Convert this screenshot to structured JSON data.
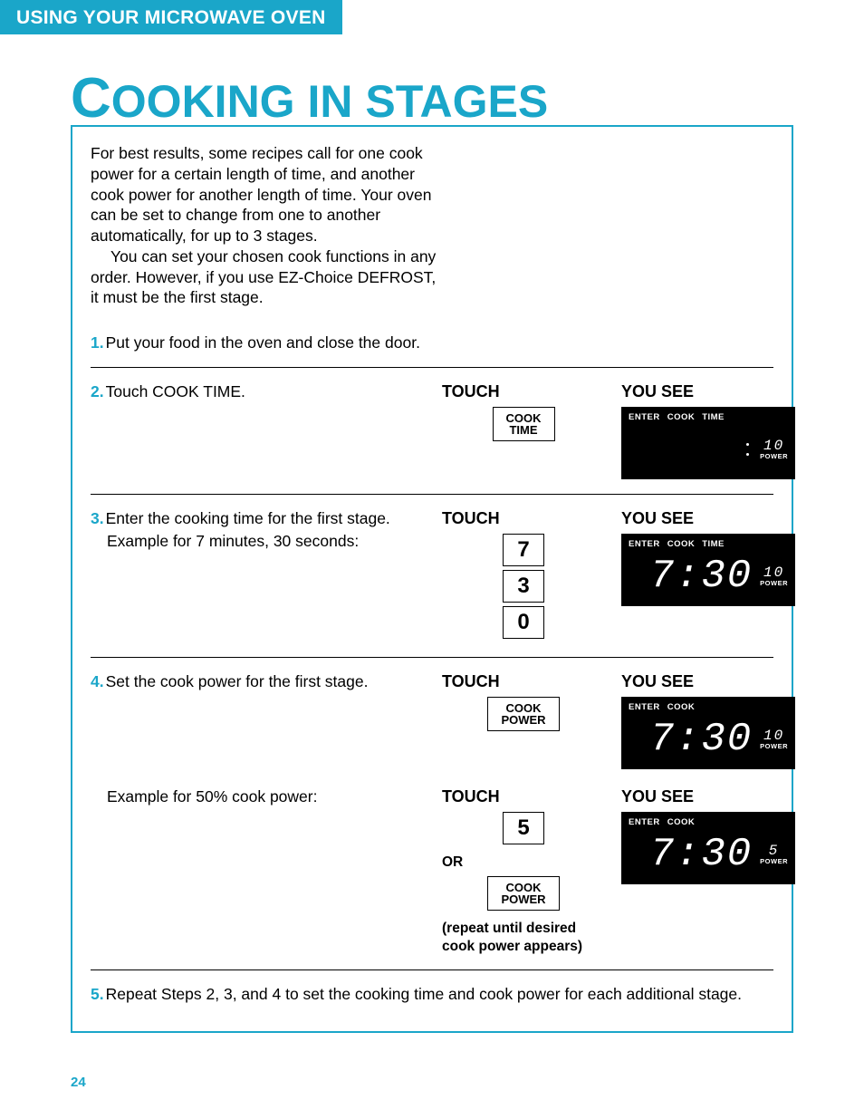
{
  "header": {
    "tab": "USING YOUR MICROWAVE OVEN"
  },
  "title": {
    "initial": "C",
    "rest": "OOKING IN STAGES"
  },
  "intro": {
    "p1": "For best results, some recipes call for one cook power for a certain length of time, and another cook power for another length of time. Your oven can be set to change from one to another automatically, for up to 3 stages.",
    "p2": "You can set your chosen cook functions in any order. However, if you use EZ-Choice DEFROST, it must be the first stage."
  },
  "steps": {
    "s1": {
      "num": "1.",
      "text": "Put your food in the oven and close the door."
    },
    "s2": {
      "num": "2.",
      "text": "Touch COOK TIME.",
      "touch": "TOUCH",
      "btn1a": "COOK",
      "btn1b": "TIME",
      "see": "YOU SEE",
      "lcdTop1": "ENTER",
      "lcdTop2": "COOK",
      "lcdTop3": "TIME",
      "lcdPwNum": "10",
      "lcdPwLbl": "POWER"
    },
    "s3": {
      "num": "3.",
      "text": "Enter the cooking time for the first stage.",
      "subtext": "Example for 7 minutes, 30 seconds:",
      "touch": "TOUCH",
      "b1": "7",
      "b2": "3",
      "b3": "0",
      "see": "YOU SEE",
      "lcdTop1": "ENTER",
      "lcdTop2": "COOK",
      "lcdTop3": "TIME",
      "lcdDigits": "7:30",
      "lcdPwNum": "10",
      "lcdPwLbl": "POWER"
    },
    "s4a": {
      "num": "4.",
      "text": "Set the cook power for the first stage.",
      "touch": "TOUCH",
      "btn1a": "COOK",
      "btn1b": "POWER",
      "see": "YOU SEE",
      "lcdTop1": "ENTER",
      "lcdTop2": "COOK",
      "lcdDigits": "7:30",
      "lcdPwNum": "10",
      "lcdPwLbl": "POWER"
    },
    "s4b": {
      "subtext": "Example for 50% cook power:",
      "touch": "TOUCH",
      "b1": "5",
      "or": "OR",
      "btn1a": "COOK",
      "btn1b": "POWER",
      "repeat": "(repeat until desired cook power appears)",
      "see": "YOU SEE",
      "lcdTop1": "ENTER",
      "lcdTop2": "COOK",
      "lcdDigits": "7:30",
      "lcdPwNum": "5",
      "lcdPwLbl": "POWER"
    },
    "s5": {
      "num": "5.",
      "text": "Repeat Steps 2, 3, and 4 to set the cooking time and cook power for each additional stage."
    }
  },
  "pageNumber": "24"
}
